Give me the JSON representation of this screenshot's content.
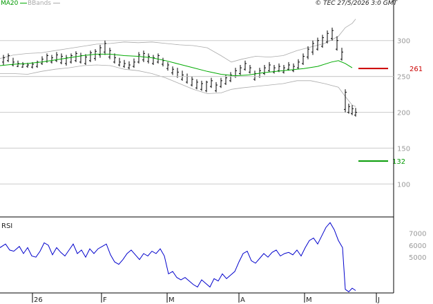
{
  "legend": {
    "ma_label": "MA20",
    "bb_label": "BBands",
    "ma_color": "#00aa00",
    "bb_color": "#aaaaaa"
  },
  "copyright": "© TEC 27/5/2026 3:0 GMT",
  "indicator_label": "RSI",
  "chart_data": [
    {
      "type": "line",
      "panel": "price",
      "x_ticks": [
        "26",
        "F",
        "M",
        "A",
        "M",
        "J"
      ],
      "ylim": [
        55,
        345
      ],
      "y_ticks": [
        100,
        150,
        200,
        250,
        300
      ],
      "grid": true,
      "series": [
        {
          "name": "MA20",
          "color": "#00aa00",
          "points": [
            [
              0,
              265
            ],
            [
              20,
              267
            ],
            [
              40,
              268
            ],
            [
              60,
              270
            ],
            [
              80,
              273
            ],
            [
              100,
              276
            ],
            [
              120,
              279
            ],
            [
              140,
              281
            ],
            [
              160,
              281
            ],
            [
              180,
              279
            ],
            [
              200,
              278
            ],
            [
              220,
              276
            ],
            [
              240,
              272
            ],
            [
              260,
              267
            ],
            [
              280,
              262
            ],
            [
              300,
              257
            ],
            [
              320,
              253
            ],
            [
              340,
              251
            ],
            [
              360,
              252
            ],
            [
              380,
              255
            ],
            [
              400,
              257
            ],
            [
              420,
              259
            ],
            [
              440,
              261
            ],
            [
              460,
              264
            ],
            [
              480,
              270
            ],
            [
              490,
              272
            ],
            [
              500,
              268
            ],
            [
              510,
              262
            ]
          ]
        },
        {
          "name": "BBands",
          "color": "#aaaaaa",
          "points": [
            [
              0,
              275
            ],
            [
              20,
              280
            ],
            [
              40,
              282
            ],
            [
              60,
              283
            ],
            [
              80,
              286
            ],
            [
              100,
              289
            ],
            [
              120,
              292
            ],
            [
              140,
              295
            ],
            [
              160,
              296
            ],
            [
              180,
              298
            ],
            [
              200,
              297
            ],
            [
              220,
              298
            ],
            [
              240,
              296
            ],
            [
              260,
              294
            ],
            [
              280,
              293
            ],
            [
              300,
              290
            ],
            [
              320,
              279
            ],
            [
              335,
              270
            ],
            [
              350,
              274
            ],
            [
              370,
              278
            ],
            [
              390,
              277
            ],
            [
              410,
              279
            ],
            [
              430,
              286
            ],
            [
              450,
              291
            ],
            [
              470,
              296
            ],
            [
              490,
              306
            ],
            [
              500,
              318
            ],
            [
              510,
              324
            ],
            [
              515,
              330
            ]
          ]
        },
        {
          "name": "BBands_lower",
          "color": "#aaaaaa",
          "points": [
            [
              0,
              254
            ],
            [
              20,
              254
            ],
            [
              40,
              253
            ],
            [
              60,
              257
            ],
            [
              80,
              260
            ],
            [
              100,
              262
            ],
            [
              120,
              265
            ],
            [
              140,
              266
            ],
            [
              160,
              265
            ],
            [
              180,
              260
            ],
            [
              200,
              258
            ],
            [
              220,
              254
            ],
            [
              240,
              248
            ],
            [
              260,
              240
            ],
            [
              280,
              232
            ],
            [
              300,
              226
            ],
            [
              320,
              227
            ],
            [
              335,
              232
            ],
            [
              350,
              234
            ],
            [
              370,
              236
            ],
            [
              390,
              238
            ],
            [
              410,
              240
            ],
            [
              430,
              244
            ],
            [
              450,
              244
            ],
            [
              470,
              240
            ],
            [
              490,
              235
            ],
            [
              500,
              222
            ],
            [
              510,
              210
            ],
            [
              515,
              208
            ]
          ]
        }
      ],
      "bars": [
        [
          5,
          266,
          280,
          270,
          276
        ],
        [
          12,
          270,
          282,
          272,
          279
        ],
        [
          19,
          264,
          276,
          266,
          270
        ],
        [
          26,
          263,
          272,
          264,
          268
        ],
        [
          33,
          262,
          270,
          263,
          267
        ],
        [
          40,
          262,
          269,
          264,
          266
        ],
        [
          47,
          261,
          270,
          263,
          267
        ],
        [
          54,
          262,
          272,
          264,
          270
        ],
        [
          61,
          266,
          278,
          268,
          274
        ],
        [
          68,
          269,
          282,
          271,
          279
        ],
        [
          75,
          268,
          280,
          270,
          276
        ],
        [
          82,
          270,
          284,
          272,
          280
        ],
        [
          89,
          267,
          282,
          269,
          278
        ],
        [
          96,
          265,
          280,
          268,
          276
        ],
        [
          103,
          268,
          282,
          270,
          279
        ],
        [
          110,
          270,
          285,
          272,
          282
        ],
        [
          117,
          268,
          283,
          270,
          279
        ],
        [
          124,
          266,
          281,
          268,
          277
        ],
        [
          131,
          270,
          286,
          272,
          283
        ],
        [
          138,
          272,
          288,
          275,
          285
        ],
        [
          145,
          276,
          294,
          280,
          290
        ],
        [
          152,
          280,
          300,
          284,
          296
        ],
        [
          159,
          274,
          290,
          277,
          286
        ],
        [
          166,
          268,
          282,
          270,
          276
        ],
        [
          173,
          264,
          276,
          266,
          270
        ],
        [
          180,
          262,
          273,
          264,
          268
        ],
        [
          187,
          260,
          271,
          262,
          266
        ],
        [
          194,
          262,
          275,
          264,
          270
        ],
        [
          201,
          268,
          284,
          270,
          280
        ],
        [
          208,
          270,
          286,
          273,
          282
        ],
        [
          215,
          268,
          282,
          271,
          278
        ],
        [
          222,
          266,
          280,
          268,
          276
        ],
        [
          229,
          268,
          282,
          270,
          279
        ],
        [
          236,
          264,
          276,
          267,
          272
        ],
        [
          243,
          258,
          270,
          261,
          266
        ],
        [
          250,
          252,
          264,
          255,
          260
        ],
        [
          257,
          248,
          262,
          250,
          256
        ],
        [
          264,
          244,
          258,
          246,
          252
        ],
        [
          271,
          240,
          254,
          242,
          250
        ],
        [
          278,
          236,
          250,
          238,
          246
        ],
        [
          285,
          232,
          246,
          234,
          242
        ],
        [
          292,
          230,
          244,
          232,
          240
        ],
        [
          299,
          228,
          244,
          230,
          242
        ],
        [
          306,
          234,
          248,
          236,
          244
        ],
        [
          313,
          228,
          242,
          230,
          238
        ],
        [
          320,
          234,
          248,
          236,
          244
        ],
        [
          327,
          238,
          252,
          240,
          248
        ],
        [
          334,
          242,
          256,
          244,
          252
        ],
        [
          341,
          248,
          262,
          250,
          258
        ],
        [
          348,
          252,
          266,
          254,
          262
        ],
        [
          355,
          258,
          272,
          260,
          268
        ],
        [
          362,
          254,
          266,
          256,
          262
        ],
        [
          369,
          244,
          258,
          246,
          254
        ],
        [
          376,
          248,
          262,
          250,
          258
        ],
        [
          383,
          252,
          266,
          254,
          262
        ],
        [
          390,
          256,
          270,
          258,
          266
        ],
        [
          397,
          254,
          266,
          256,
          262
        ],
        [
          404,
          256,
          268,
          258,
          264
        ],
        [
          411,
          254,
          266,
          256,
          262
        ],
        [
          418,
          258,
          270,
          260,
          266
        ],
        [
          425,
          256,
          268,
          258,
          264
        ],
        [
          432,
          260,
          274,
          262,
          270
        ],
        [
          439,
          266,
          282,
          268,
          278
        ],
        [
          446,
          274,
          292,
          277,
          288
        ],
        [
          453,
          280,
          300,
          284,
          296
        ],
        [
          460,
          286,
          304,
          288,
          300
        ],
        [
          467,
          290,
          308,
          292,
          304
        ],
        [
          474,
          296,
          314,
          298,
          310
        ],
        [
          481,
          300,
          318,
          303,
          314
        ],
        [
          488,
          286,
          306,
          288,
          300
        ],
        [
          495,
          272,
          290,
          274,
          284
        ]
      ],
      "bars_post": [
        [
          500,
          200,
          232,
          204,
          228
        ],
        [
          505,
          198,
          212,
          200,
          208
        ],
        [
          510,
          196,
          210,
          198,
          205
        ],
        [
          515,
          194,
          206,
          196,
          200
        ]
      ],
      "levels": [
        {
          "label": "261",
          "value": 261,
          "color": "#cc0000"
        },
        {
          "label": "132",
          "value": 132,
          "color": "#009900"
        }
      ]
    },
    {
      "type": "line",
      "panel": "RSI",
      "name": "RSI",
      "color": "#0000cc",
      "ylim": [
        2000,
        8200
      ],
      "y_ticks": [
        5000,
        6000,
        7000
      ],
      "y_tick_labels": [
        "5000",
        "6000",
        "7000"
      ],
      "points": [
        [
          0,
          5800
        ],
        [
          8,
          6100
        ],
        [
          14,
          5600
        ],
        [
          20,
          5500
        ],
        [
          28,
          5900
        ],
        [
          34,
          5300
        ],
        [
          40,
          5800
        ],
        [
          46,
          5100
        ],
        [
          52,
          5000
        ],
        [
          58,
          5500
        ],
        [
          64,
          6200
        ],
        [
          70,
          6000
        ],
        [
          76,
          5200
        ],
        [
          82,
          5800
        ],
        [
          88,
          5400
        ],
        [
          94,
          5100
        ],
        [
          100,
          5600
        ],
        [
          106,
          6100
        ],
        [
          112,
          5300
        ],
        [
          118,
          5600
        ],
        [
          124,
          5000
        ],
        [
          130,
          5700
        ],
        [
          136,
          5300
        ],
        [
          142,
          5700
        ],
        [
          148,
          5900
        ],
        [
          154,
          6100
        ],
        [
          160,
          5200
        ],
        [
          166,
          4600
        ],
        [
          172,
          4400
        ],
        [
          178,
          4800
        ],
        [
          184,
          5300
        ],
        [
          190,
          5600
        ],
        [
          196,
          5200
        ],
        [
          202,
          4800
        ],
        [
          208,
          5300
        ],
        [
          214,
          5100
        ],
        [
          220,
          5500
        ],
        [
          226,
          5300
        ],
        [
          232,
          5700
        ],
        [
          238,
          5100
        ],
        [
          244,
          3600
        ],
        [
          250,
          3800
        ],
        [
          256,
          3300
        ],
        [
          262,
          3100
        ],
        [
          268,
          3300
        ],
        [
          274,
          3000
        ],
        [
          280,
          2700
        ],
        [
          286,
          2500
        ],
        [
          292,
          3100
        ],
        [
          298,
          2800
        ],
        [
          304,
          2500
        ],
        [
          310,
          3200
        ],
        [
          316,
          3000
        ],
        [
          322,
          3600
        ],
        [
          328,
          3200
        ],
        [
          334,
          3500
        ],
        [
          340,
          3800
        ],
        [
          346,
          4600
        ],
        [
          352,
          5300
        ],
        [
          358,
          5500
        ],
        [
          364,
          4700
        ],
        [
          370,
          4500
        ],
        [
          376,
          4900
        ],
        [
          382,
          5300
        ],
        [
          388,
          5000
        ],
        [
          394,
          5400
        ],
        [
          400,
          5600
        ],
        [
          406,
          5100
        ],
        [
          412,
          5300
        ],
        [
          418,
          5400
        ],
        [
          424,
          5200
        ],
        [
          430,
          5600
        ],
        [
          436,
          5100
        ],
        [
          442,
          5800
        ],
        [
          448,
          6400
        ],
        [
          454,
          6600
        ],
        [
          460,
          6100
        ],
        [
          466,
          6800
        ],
        [
          472,
          7500
        ],
        [
          478,
          7900
        ],
        [
          484,
          7300
        ],
        [
          490,
          6400
        ],
        [
          496,
          5800
        ],
        [
          500,
          2300
        ],
        [
          505,
          2100
        ],
        [
          510,
          2400
        ],
        [
          515,
          2200
        ]
      ]
    }
  ]
}
